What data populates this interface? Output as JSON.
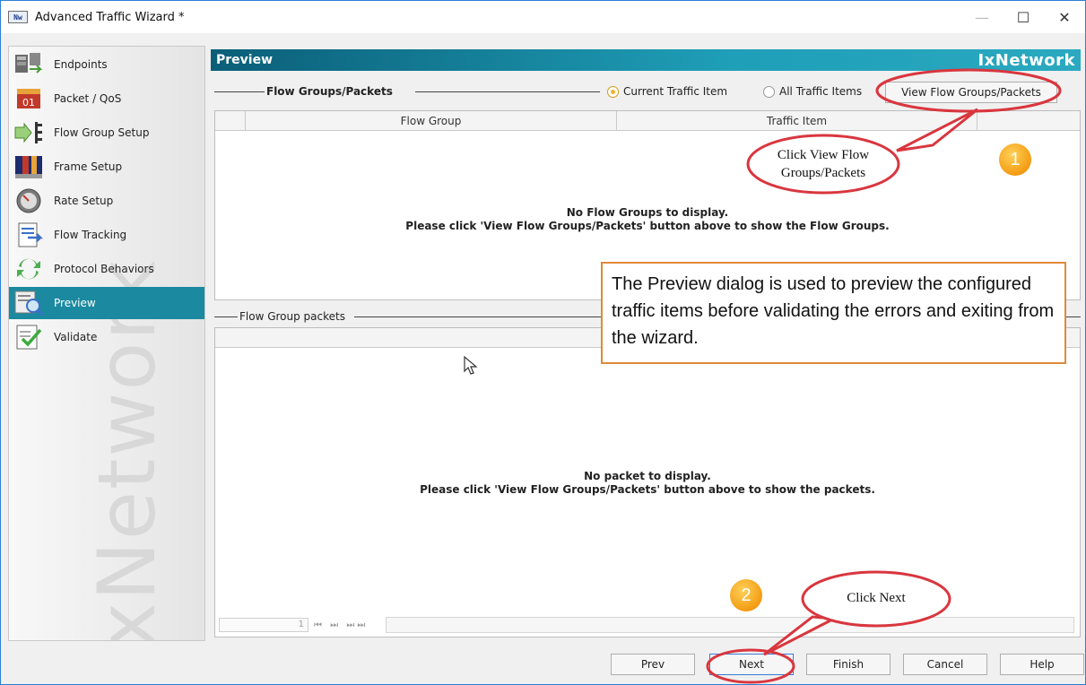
{
  "window": {
    "app_icon": "Nw",
    "title": "Advanced Traffic Wizard *",
    "controls": {
      "minimize": "—",
      "maximize": "☐",
      "close": "✕"
    }
  },
  "sidebar": {
    "items": [
      {
        "label": "Endpoints",
        "icon": "endpoints-icon"
      },
      {
        "label": "Packet / QoS",
        "icon": "packet-qos-icon"
      },
      {
        "label": "Flow Group Setup",
        "icon": "flow-group-setup-icon"
      },
      {
        "label": "Frame Setup",
        "icon": "frame-setup-icon"
      },
      {
        "label": "Rate Setup",
        "icon": "rate-setup-icon"
      },
      {
        "label": "Flow Tracking",
        "icon": "flow-tracking-icon"
      },
      {
        "label": "Protocol Behaviors",
        "icon": "protocol-behaviors-icon"
      },
      {
        "label": "Preview",
        "icon": "preview-icon",
        "active": true
      },
      {
        "label": "Validate",
        "icon": "validate-icon"
      }
    ],
    "watermark": "IxNetwork"
  },
  "header": {
    "title": "Preview",
    "brand": "IxNetwork"
  },
  "flow_groups": {
    "section_label": "Flow Groups/Packets",
    "radio_current": "Current Traffic Item",
    "radio_all": "All Traffic Items",
    "view_button": "View Flow Groups/Packets",
    "columns": [
      "Flow Group",
      "Traffic Item"
    ],
    "empty_line1": "No Flow Groups to display.",
    "empty_line2": "Please click 'View Flow Groups/Packets' button above to show the Flow Groups."
  },
  "packets": {
    "section_label": "Flow Group packets",
    "empty_line1": "No packet to display.",
    "empty_line2": "Please click 'View Flow Groups/Packets' button above to show the packets.",
    "page_number": "1",
    "pager_controls": "⏮ ⏭ ⏭⏭"
  },
  "footer_buttons": {
    "prev": "Prev",
    "next": "Next",
    "finish": "Finish",
    "cancel": "Cancel",
    "help": "Help"
  },
  "annotations": {
    "description": "The Preview dialog is used to preview the configured traffic items before validating the errors and exiting from the wizard.",
    "bubble1": "Click View Flow Groups/Packets",
    "bubble2": "Click  Next",
    "step1": "1",
    "step2": "2",
    "accent_red": "#d9363e",
    "badge_orange": "#f39c12",
    "box_orange": "#e0893a"
  }
}
